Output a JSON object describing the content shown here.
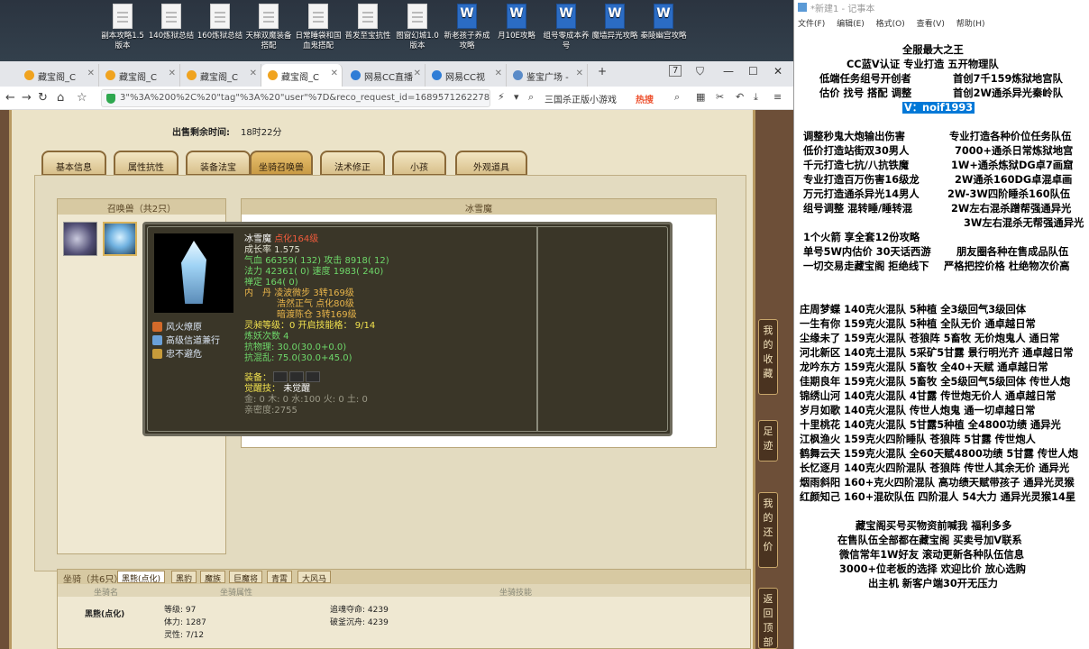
{
  "desktop": {
    "icons": [
      {
        "label": "副本攻略1.5版本",
        "type": "doc"
      },
      {
        "label": "140炼狱总结",
        "type": "doc"
      },
      {
        "label": "160炼狱总结",
        "type": "doc"
      },
      {
        "label": "天梯双魔装备搭配",
        "type": "doc"
      },
      {
        "label": "日常睡袋和国血鬼搭配",
        "type": "doc"
      },
      {
        "label": "普发至宝抗性",
        "type": "doc"
      },
      {
        "label": "图窗幻城1.0版本",
        "type": "doc"
      },
      {
        "label": "新老孩子养成攻略",
        "type": "word"
      },
      {
        "label": "月10E攻略",
        "type": "word"
      },
      {
        "label": "组号零成本养号",
        "type": "word"
      },
      {
        "label": "魔墙异光攻略",
        "type": "word"
      },
      {
        "label": "秦陵幽宫攻略",
        "type": "word"
      }
    ]
  },
  "browser": {
    "tabs": [
      {
        "label": "藏宝阁_C"
      },
      {
        "label": "藏宝阁_C"
      },
      {
        "label": "藏宝阁_C"
      },
      {
        "label": "藏宝阁_C"
      },
      {
        "label": "网易CC直播"
      },
      {
        "label": "网易CC视"
      },
      {
        "label": "鉴宝广场 -"
      }
    ],
    "new_tab": "+",
    "tab_count": "7",
    "url": "3\"%3A%200%2C%20\"tag\"%3A%20\"user\"%7D&reco_request_id=1689571262278Cstl",
    "search": "三国杀正版小游戏",
    "hot_label": "热搜"
  },
  "game": {
    "sell_time_label": "出售剩余时间:",
    "sell_time_value": "18时22分",
    "tabs": [
      "基本信息",
      "属性抗性",
      "装备法宝",
      "坐骑召唤兽",
      "法术修正",
      "小孩",
      "外观道具"
    ],
    "summon_header": "召唤兽（共2只）",
    "detail_header": "冰雪魔",
    "side_buttons": [
      "我的收藏",
      "足迹",
      "我的还价",
      "返回顶部"
    ],
    "mount": {
      "header": "坐骑（共6只）",
      "tabs": [
        "黑熊(点化)",
        "黑豹",
        "魔族",
        "巨魔将",
        "青霄",
        "大风马"
      ],
      "col_name": "坐骑名",
      "col_attr": "坐骑属性",
      "col_skill": "坐骑技能",
      "name": "黑熊(点化)",
      "stats": [
        "等级: 97",
        "体力: 1287",
        "灵性: 7/12"
      ],
      "skills": [
        "追魂夺命: 4239",
        "破釜沉舟: 4239"
      ]
    },
    "tooltip": {
      "name": "冰雪魔",
      "tag": "点化164级",
      "growth": "成长率 1.575",
      "hp_label": "气血",
      "hp": "66359( 132)",
      "atk_label": "攻击",
      "atk": "8918( 12)",
      "mp_label": "法力",
      "mp": "42361( 0)",
      "spd_label": "速度",
      "spd": "1983( 240)",
      "zen": "禅定 164( 0)",
      "neidan_label": "内　丹",
      "neidan": [
        "凌波微步 3转169级",
        "浩然正气 点化80级",
        "暗渡陈仓 3转169级"
      ],
      "soul_label": "灵昶等级：",
      "soul_value": "0 开启技能格： 9/14",
      "lianyao": "炼妖次数 4",
      "resist_phys": "抗物理: 30.0(30.0+0.0)",
      "resist_mix": "抗混乱: 75.0(30.0+45.0)",
      "equip_label": "装备：",
      "awaken_label": "觉醒技：",
      "awaken_value": "未觉醒",
      "elements": "金: 0 木: 0 水:100 火: 0 土: 0",
      "intimacy": "亲密度:2755",
      "skills": [
        "风火燎原",
        "高级信道兼行",
        "忠不避危"
      ]
    }
  },
  "notepad": {
    "title": "*新建1 - 记事本",
    "menu": [
      "文件(F)",
      "编辑(E)",
      "格式(O)",
      "查看(V)",
      "帮助(H)"
    ],
    "header_lines": [
      "全服最大之王",
      "CC蓝V认证 专业打造 五开物理队",
      "低端任务组号开创者",
      "首创7千159炼狱地宫队",
      "估价 找号 搭配 调整",
      "首创2W通杀异光秦岭队"
    ],
    "contact": "V：noif1993",
    "lines_left": [
      "调整秒鬼大炮输出伤害",
      "低价打造站街双30男人",
      "千元打造七抗/八抗铁魔",
      "专业打造百万伤害16级龙",
      "万元打造通杀异光14男人",
      "组号调整 混转睡/睡转混"
    ],
    "lines_right": [
      "专业打造各种价位任务队伍",
      "7000+通杀日常炼狱地宫",
      "1W+通杀炼狱DG卓7画窟",
      "2W通杀160DG卓混卓画",
      "2W-3W四阶睡杀160队伍",
      "2W左右混杀蹭帮强通异光",
      "3W左右混杀无帮强通异光"
    ],
    "promo": [
      "1个火箭 享全套12份攻略",
      "单号5W内估价 30天话西游",
      "朋友圈各种在售成品队伍",
      "一切交易走藏宝阁 拒绝线下",
      "严格把控价格 杜绝物次价高"
    ],
    "teams": [
      "庄周梦蝶 140克火混队 5种植 全3级回气3级回体",
      "一生有你 159克火混队 5种植 全队无价 通卓越日常",
      "尘缘未了 159克火混队 苍狼阵 5畜牧 无价炮鬼人 通日常",
      "河北新区 140克土混队 5采矿5甘露 景行明光齐 通卓越日常",
      "龙吟东方 159克火混队 5畜牧 全40+天赋 通卓越日常",
      "佳期良年 159克火混队 5畜牧 全5级回气5级回体 传世人炮",
      "锦绣山河 140克火混队 4甘露 传世炮无价人 通卓越日常",
      "岁月如歌 140克火混队 传世人炮鬼 通一切卓越日常",
      "十里桃花 140克火混队 5甘露5种植 全4800功绩 通异光",
      "江枫渔火 159克火四阶睡队 苍狼阵 5甘露 传世炮人",
      "鹤舞云天 159克火混队 全60天赋4800功绩 5甘露 传世人炮",
      "长忆逐月 140克火四阶混队 苍狼阵 传世人其余无价 通异光",
      "烟雨斜阳 160+克火四阶混队 高功绩天赋带孩子 通异光灵猴",
      "红颜知己 160+混砍队伍 四阶混人 54大力 通异光灵猴14星"
    ],
    "footer": [
      "藏宝阁买号买物资前喊我 福利多多",
      "在售队伍全部都在藏宝阁 买卖号加V联系",
      "微信常年1W好友 滚动更新各种队伍信息",
      "3000+位老板的选择 欢迎比价 放心选购",
      "出主机 新客户端30开无压力"
    ]
  }
}
